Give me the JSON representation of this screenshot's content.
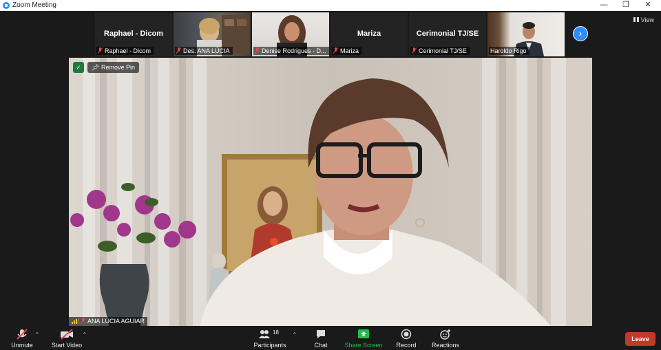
{
  "window": {
    "title": "Zoom Meeting",
    "controls": {
      "minimize": "—",
      "restore": "❐",
      "close": "✕"
    }
  },
  "gallery": {
    "view_label": "View",
    "next_icon": "chevron-right-icon",
    "tiles": [
      {
        "big_name": "Raphael - Dicom",
        "name": "Raphael - Dicom",
        "has_video": false
      },
      {
        "big_name": "",
        "name": "Des. ANA LÚCIA",
        "has_video": true
      },
      {
        "big_name": "",
        "name": "Denise Rodrigues - D...",
        "has_video": true
      },
      {
        "big_name": "Mariza",
        "name": "Mariza",
        "has_video": false
      },
      {
        "big_name": "Cerimonial TJ/SE",
        "name": "Cerimonial TJ/SE",
        "has_video": false
      },
      {
        "big_name": "",
        "name": "Haroldo Rigo",
        "has_video": true
      }
    ]
  },
  "main": {
    "remove_pin_label": "Remove Pin",
    "speaker_name": "ANA LÚCIA AGUIAR"
  },
  "toolbar": {
    "unmute": "Unmute",
    "start_video": "Start Video",
    "participants": "Participants",
    "participants_count": "18",
    "chat": "Chat",
    "share_screen": "Share Screen",
    "record": "Record",
    "reactions": "Reactions",
    "leave": "Leave"
  },
  "colors": {
    "accent": "#2d8cff",
    "share_green": "#1fbf4a",
    "leave_red": "#c0392b",
    "muted_red": "#e5484d"
  }
}
